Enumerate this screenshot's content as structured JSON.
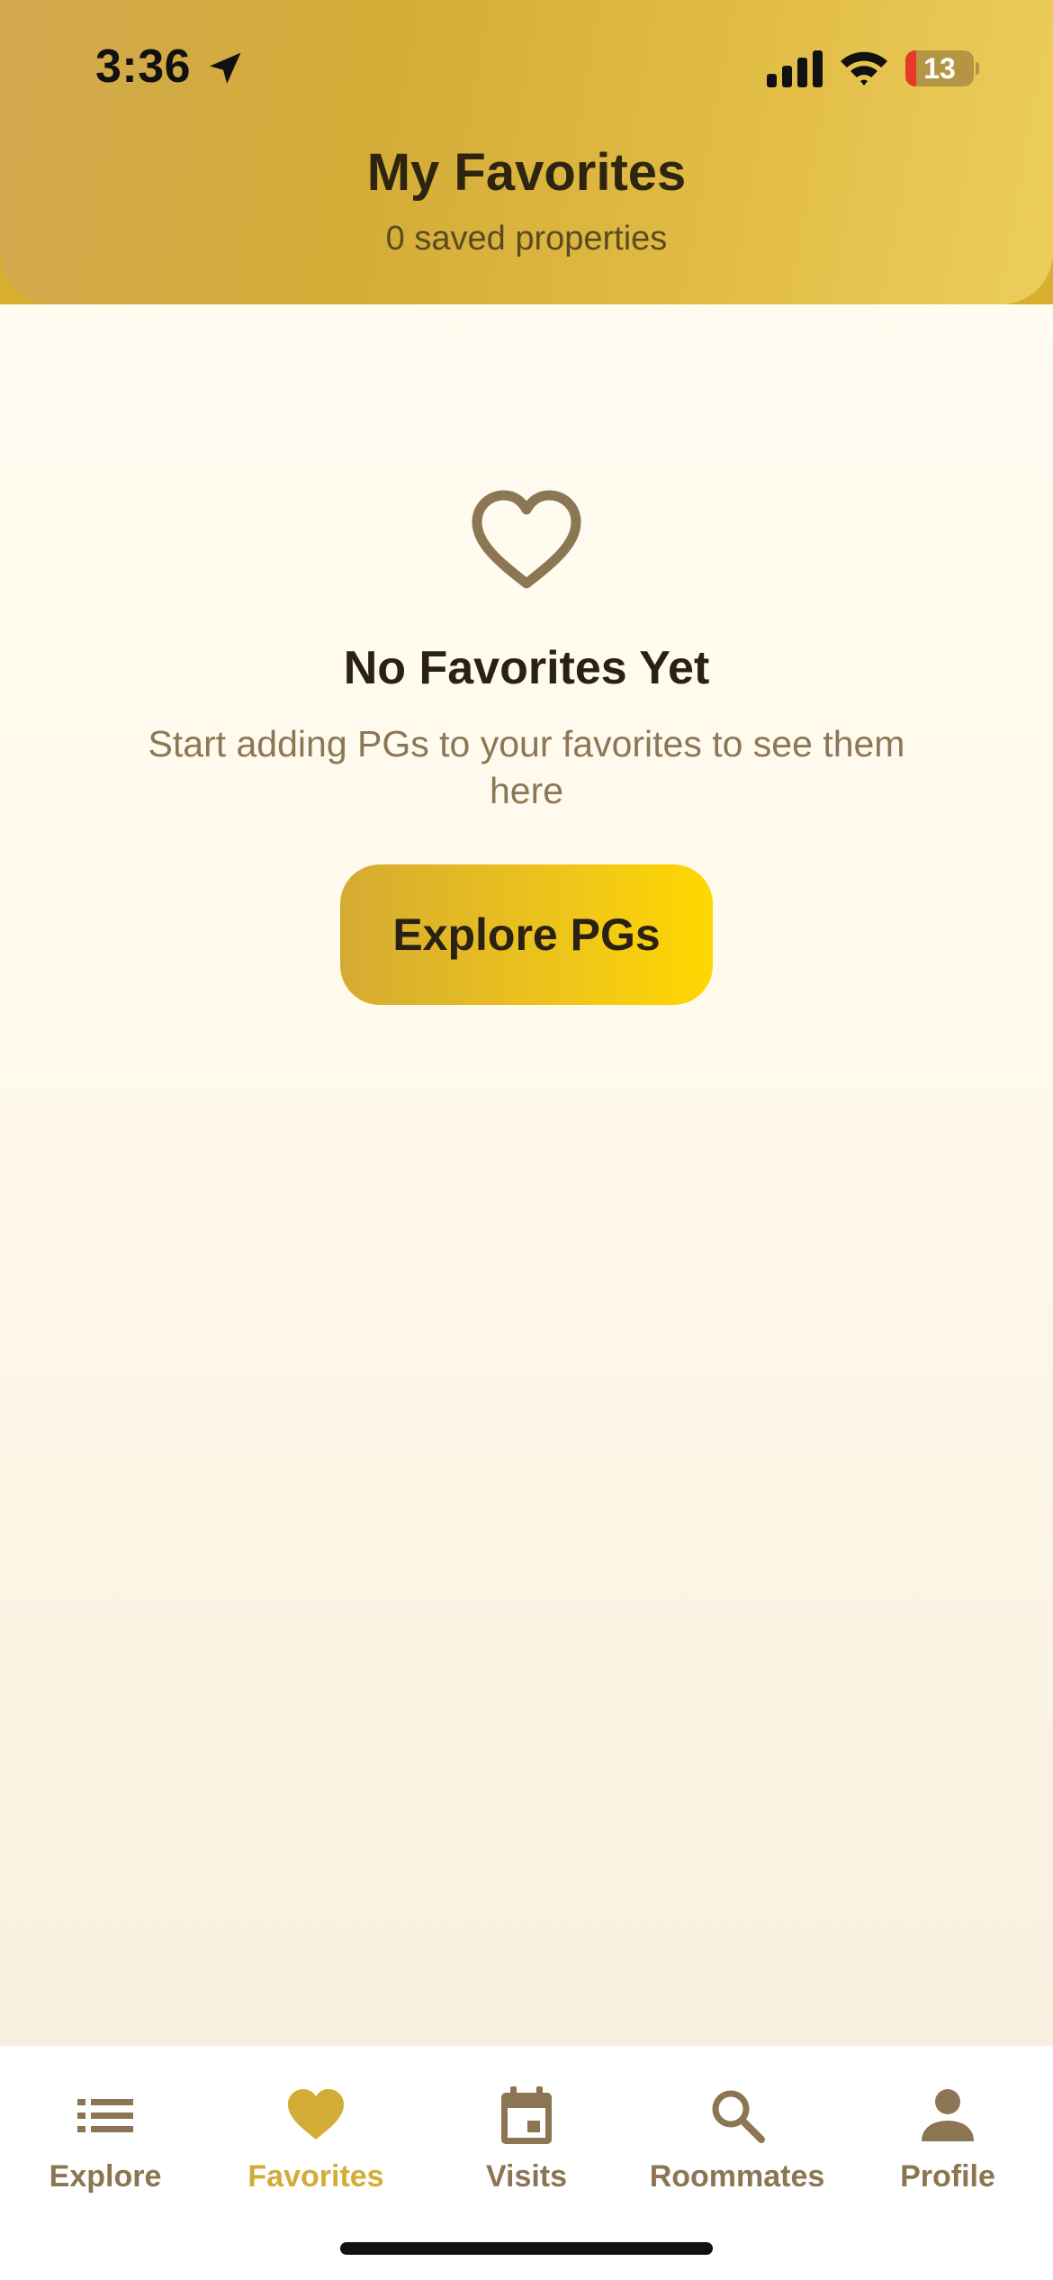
{
  "status_bar": {
    "time": "3:36",
    "battery_level": "13"
  },
  "header": {
    "title": "My Favorites",
    "subtitle": "0 saved properties"
  },
  "empty_state": {
    "icon": "heart-outline-icon",
    "title": "No Favorites Yet",
    "message": "Start adding PGs to your favorites to see them here",
    "button_label": "Explore PGs"
  },
  "tabs": [
    {
      "label": "Explore",
      "icon": "list-icon",
      "active": false
    },
    {
      "label": "Favorites",
      "icon": "heart-icon",
      "active": true
    },
    {
      "label": "Visits",
      "icon": "calendar-icon",
      "active": false
    },
    {
      "label": "Roommates",
      "icon": "search-icon",
      "active": false
    },
    {
      "label": "Profile",
      "icon": "person-icon",
      "active": false
    }
  ],
  "colors": {
    "accent": "#d3ac37",
    "tab_inactive": "#8b7553",
    "text_dark": "#2a2112",
    "button_gradient_end": "#ffd700"
  }
}
